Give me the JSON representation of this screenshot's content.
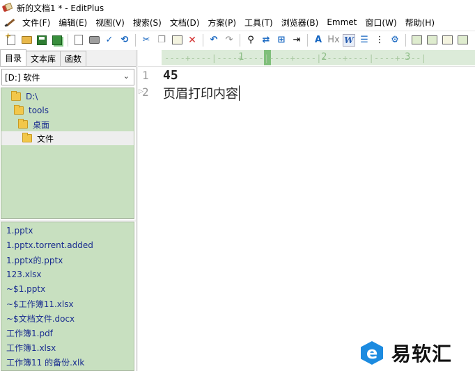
{
  "window": {
    "title": "新的文档1 * - EditPlus"
  },
  "menu": [
    "文件(F)",
    "编辑(E)",
    "视图(V)",
    "搜索(S)",
    "文档(D)",
    "方案(P)",
    "工具(T)",
    "浏览器(B)",
    "Emmet",
    "窗口(W)",
    "帮助(H)"
  ],
  "toolbar": {
    "tools": [
      "new-file-icon",
      "open-folder-icon",
      "save-icon",
      "save-all-icon",
      "print-preview-icon",
      "print-icon",
      "spellcheck-icon",
      "browser-preview-icon",
      "cut-icon",
      "copy-icon",
      "paste-icon",
      "delete-icon",
      "undo-icon",
      "redo-icon",
      "find-icon",
      "replace-icon",
      "find-in-files-icon",
      "goto-line-icon",
      "font-icon",
      "hex-icon",
      "word-wrap-icon",
      "line-number-icon",
      "column-select-icon",
      "settings-icon",
      "cliptext-icon",
      "directory-icon",
      "output-icon",
      "user-tool-icon"
    ]
  },
  "sidebar": {
    "tabs": [
      "目录",
      "文本库",
      "函数"
    ],
    "active_tab": "目录",
    "drive": "[D:] 软件",
    "folders": [
      {
        "label": "D:\\",
        "selected": false
      },
      {
        "label": "tools",
        "selected": false
      },
      {
        "label": "桌面",
        "selected": false
      },
      {
        "label": "文件",
        "selected": true
      }
    ],
    "files": [
      "1.pptx",
      "1.pptx.torrent.added",
      "1.pptx的.pptx",
      "123.xlsx",
      "~$1.pptx",
      "~$工作簿11.xlsx",
      "~$文档文件.docx",
      "工作簿1.pdf",
      "工作簿1.xlsx",
      "工作簿11 的备份.xlk"
    ]
  },
  "ruler": {
    "marks": [
      "1",
      "2",
      "3"
    ]
  },
  "editor": {
    "lines": [
      {
        "number": "1",
        "text": "45"
      },
      {
        "number": "2",
        "text": "页眉打印内容"
      }
    ]
  },
  "watermark": {
    "text": "易软汇"
  }
}
